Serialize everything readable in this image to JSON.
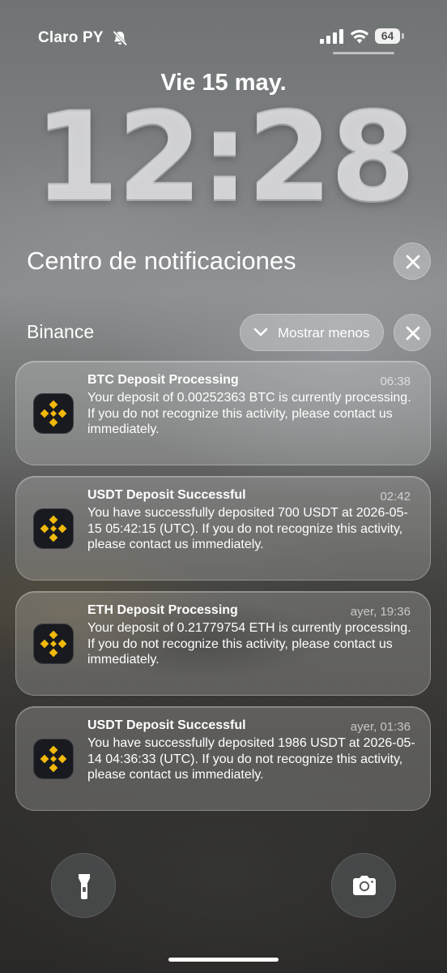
{
  "status_bar": {
    "carrier": "Claro PY",
    "battery": "64",
    "icons": [
      "bell-slash-icon",
      "cellular-signal-icon",
      "wifi-icon",
      "battery-icon"
    ]
  },
  "lock_screen": {
    "date": "Vie 15 may.",
    "time": "12:28"
  },
  "notification_center": {
    "title": "Centro de notificaciones",
    "group": {
      "app_name": "Binance",
      "show_less_label": "Mostrar menos",
      "notifications": [
        {
          "title": "BTC Deposit Processing",
          "time": "06:38",
          "body": "Your deposit of 0.00252363 BTC is currently processing. If you do not recognize this activity, please contact us immediately."
        },
        {
          "title": "USDT Deposit Successful",
          "time": "02:42",
          "body": "You have successfully deposited 700 USDT at 2026-05-15 05:42:15 (UTC). If you do not recognize this activity, please contact us immediately."
        },
        {
          "title": "ETH Deposit Processing",
          "time": "ayer, 19:36",
          "body": "Your deposit of 0.21779754 ETH is currently processing. If you do not recognize this activity, please contact us immediately."
        },
        {
          "title": "USDT Deposit Successful",
          "time": "ayer, 01:36",
          "body": "You have successfully deposited 1986 USDT at 2026-05-14 04:36:33 (UTC). If you do not recognize this activity, please contact us immediately."
        }
      ]
    }
  },
  "quick_actions": [
    "flashlight-icon",
    "camera-icon"
  ],
  "colors": {
    "binance_yellow": "#F0B90B",
    "app_icon_bg": "#181A1F"
  }
}
